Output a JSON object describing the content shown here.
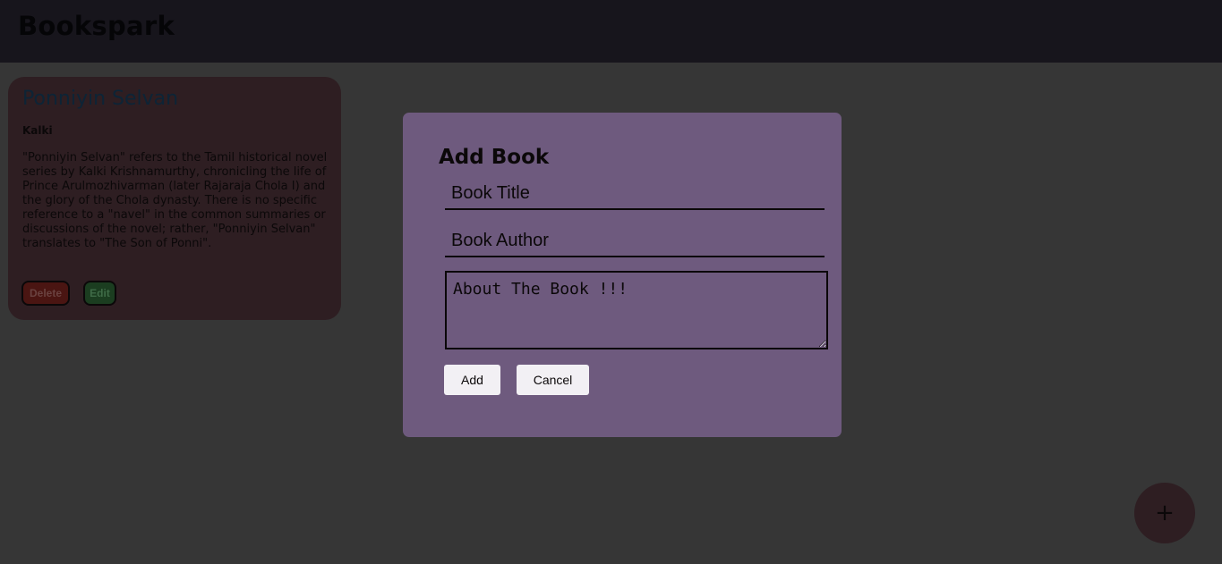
{
  "header": {
    "brand": "Bookspark"
  },
  "books": [
    {
      "title": "Ponniyin Selvan",
      "author": "Kalki",
      "description": "\"Ponniyin Selvan\" refers to the Tamil historical novel series by Kalki Krishnamurthy, chronicling the life of Prince Arulmozhivarman (later Rajaraja Chola I) and the glory of the Chola dynasty. There is no specific reference to a \"navel\" in the common summaries or discussions of the novel; rather, \"Ponniyin Selvan\" translates to \"The Son of Ponni\".",
      "delete_label": "Delete",
      "edit_label": "Edit"
    }
  ],
  "fab": {
    "label": "+"
  },
  "modal": {
    "title": "Add Book",
    "title_placeholder": "Book Title",
    "author_placeholder": "Book Author",
    "about_placeholder": "About The Book !!!",
    "add_label": "Add",
    "cancel_label": "Cancel"
  },
  "colors": {
    "page_background": "#363636",
    "header_background": "#17151c",
    "card_background": "#2e1e22",
    "modal_background": "#6e5a7e",
    "delete_button": "#4a1512",
    "edit_button": "#1b3d20"
  }
}
